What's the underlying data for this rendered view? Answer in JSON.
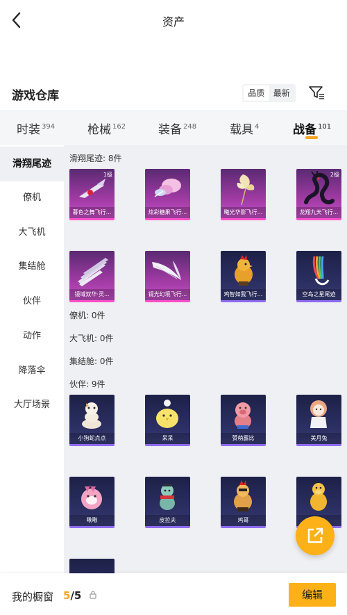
{
  "header": {
    "title": "资产"
  },
  "section": {
    "title": "游戏仓库"
  },
  "sort": {
    "options": [
      "品质",
      "最新"
    ],
    "active": 0
  },
  "tabs": [
    {
      "label": "时装",
      "count": "394"
    },
    {
      "label": "枪械",
      "count": "162"
    },
    {
      "label": "装备",
      "count": "248"
    },
    {
      "label": "载具",
      "count": "4"
    },
    {
      "label": "战备",
      "count": "101",
      "active": true
    }
  ],
  "sidebar": {
    "items": [
      "滑翔尾迹",
      "僚机",
      "大飞机",
      "集结舱",
      "伙伴",
      "动作",
      "降落伞",
      "大厅场景"
    ],
    "active": 0
  },
  "content": {
    "glide_trail": {
      "label": "滑翔尾迹: 8件",
      "items": [
        {
          "name": "暮色之舞飞行...",
          "level": "1级",
          "style": "purple",
          "icon": "red-feather-icon"
        },
        {
          "name": "炫彩糖果飞行...",
          "level": "",
          "style": "purple",
          "icon": "candy-wing-icon"
        },
        {
          "name": "曦光华影飞行...",
          "level": "",
          "style": "purple",
          "icon": "flower-wand-icon"
        },
        {
          "name": "龙翔九天飞行...",
          "level": "2级",
          "style": "purple",
          "icon": "dragon-icon"
        },
        {
          "name": "镜域双华·灵...",
          "level": "",
          "style": "purple",
          "icon": "blade-fan-icon"
        },
        {
          "name": "镜光幻境飞行...",
          "level": "",
          "style": "purple",
          "icon": "white-wing-icon"
        },
        {
          "name": "鸡智如我飞行...",
          "level": "",
          "style": "blue",
          "icon": "rooster-icon"
        },
        {
          "name": "空岛之星尾迹",
          "level": "",
          "style": "blue",
          "icon": "rainbow-trail-icon"
        }
      ]
    },
    "wingman_label": "僚机: 0件",
    "aircraft_label": "大飞机: 0件",
    "capsule_label": "集结舱: 0件",
    "companion": {
      "label": "伙伴: 9件",
      "items": [
        {
          "name": "小狗蛇点点",
          "style": "blue",
          "icon": "snake-pet-icon"
        },
        {
          "name": "呆呆",
          "style": "blue",
          "icon": "chick-pet-icon"
        },
        {
          "name": "赞萌露比",
          "style": "blue",
          "icon": "pig-pet-icon"
        },
        {
          "name": "美月兔",
          "style": "blue",
          "icon": "doll-pet-icon"
        },
        {
          "name": "啾啾",
          "style": "blue",
          "icon": "pink-bird-pet-icon"
        },
        {
          "name": "皮拉夫",
          "style": "blue",
          "icon": "scarf-pet-icon"
        },
        {
          "name": "鸡哥",
          "style": "blue",
          "icon": "rooster-pet-icon"
        },
        {
          "name": "",
          "style": "blue",
          "icon": "duck-pet-icon"
        }
      ]
    }
  },
  "bottom": {
    "label": "我的橱窗",
    "count_current": "5",
    "count_total": "/5",
    "edit_label": "编辑"
  },
  "colors": {
    "accent": "#fbb117",
    "tab_underline": "#f5a623",
    "content_bg": "#eef0f3"
  }
}
